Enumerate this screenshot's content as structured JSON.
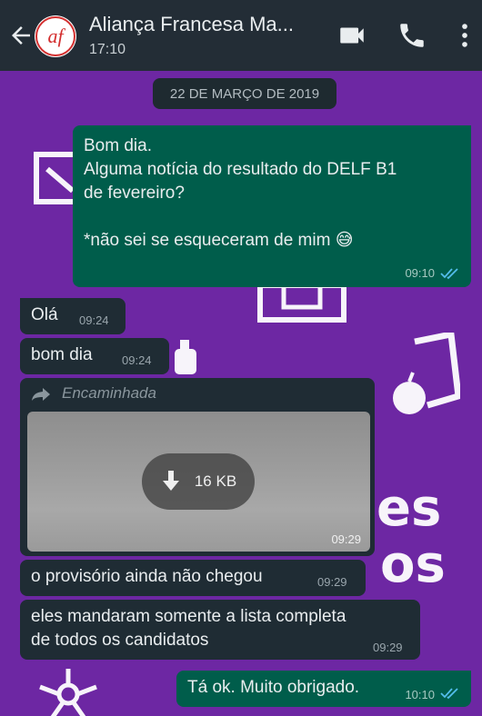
{
  "header": {
    "title": "Aliança Francesa Ma...",
    "subtitle": "17:10",
    "avatar_text": "af"
  },
  "chat": {
    "date": "22 DE MARÇO DE 2019",
    "messages": [
      {
        "direction": "out",
        "lines": [
          "Bom dia.",
          "Alguma notícia do resultado do DELF B1",
          "de fevereiro?",
          "",
          "*não sei se esqueceram de mim 😅"
        ],
        "time": "09:10",
        "status": "read"
      },
      {
        "direction": "in",
        "text": "Olá",
        "time": "09:24"
      },
      {
        "direction": "in",
        "text": "bom dia",
        "time": "09:24"
      },
      {
        "direction": "in",
        "forwarded_label": "Encaminhada",
        "download_size": "16 KB",
        "time": "09:29"
      },
      {
        "direction": "in",
        "text": "o provisório ainda não chegou",
        "time": "09:29"
      },
      {
        "direction": "in",
        "lines": [
          "eles mandaram somente a lista completa",
          "de todos os candidatos"
        ],
        "time": "09:29"
      },
      {
        "direction": "out",
        "text": "Tá ok. Muito obrigado.",
        "time": "10:10",
        "status": "read"
      }
    ]
  },
  "colors": {
    "wallpaper": "#6d27a3",
    "header_bg": "#232d36",
    "incoming_bubble": "#1f2c34",
    "outgoing_bubble": "#005d4b",
    "read_ticks": "#53bdeb"
  }
}
